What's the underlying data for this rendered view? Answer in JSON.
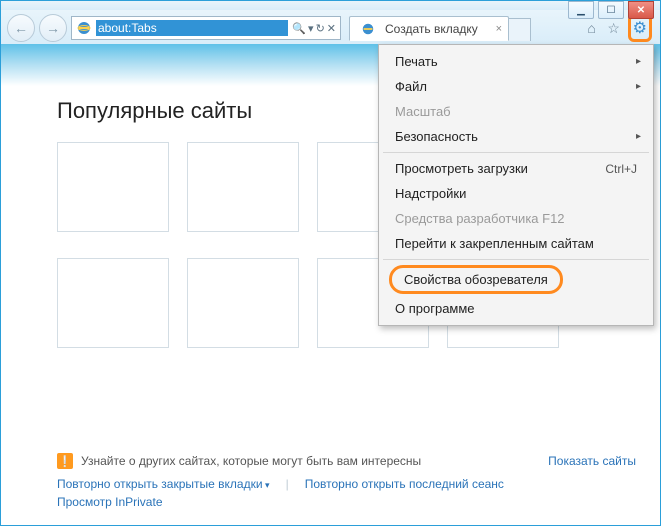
{
  "window": {
    "minimize": "▁",
    "maximize": "☐",
    "close": "✕"
  },
  "nav": {
    "back": "←",
    "forward": "→"
  },
  "address": {
    "url": "about:Tabs",
    "search_icon": "🔍",
    "dropdown": "▾",
    "refresh": "↻",
    "stop": "✕"
  },
  "tab": {
    "title": "Создать вкладку",
    "close": "×"
  },
  "toolbar": {
    "home": "⌂",
    "star": "☆",
    "gear": "⚙"
  },
  "page": {
    "title": "Популярные сайты",
    "discover_text": "Узнайте о других сайтах, которые могут быть вам интересны",
    "show_sites": "Показать сайты",
    "reopen_closed": "Повторно открыть закрытые вкладки",
    "reopen_session": "Повторно открыть последний сеанс",
    "inprivate": "Просмотр InPrivate"
  },
  "menu": {
    "print": "Печать",
    "file": "Файл",
    "zoom": "Масштаб",
    "safety": "Безопасность",
    "downloads": "Просмотреть загрузки",
    "downloads_sc": "Ctrl+J",
    "addons": "Надстройки",
    "devtools": "Средства разработчика F12",
    "pinned": "Перейти к закрепленным сайтам",
    "options": "Свойства обозревателя",
    "about": "О программе"
  }
}
